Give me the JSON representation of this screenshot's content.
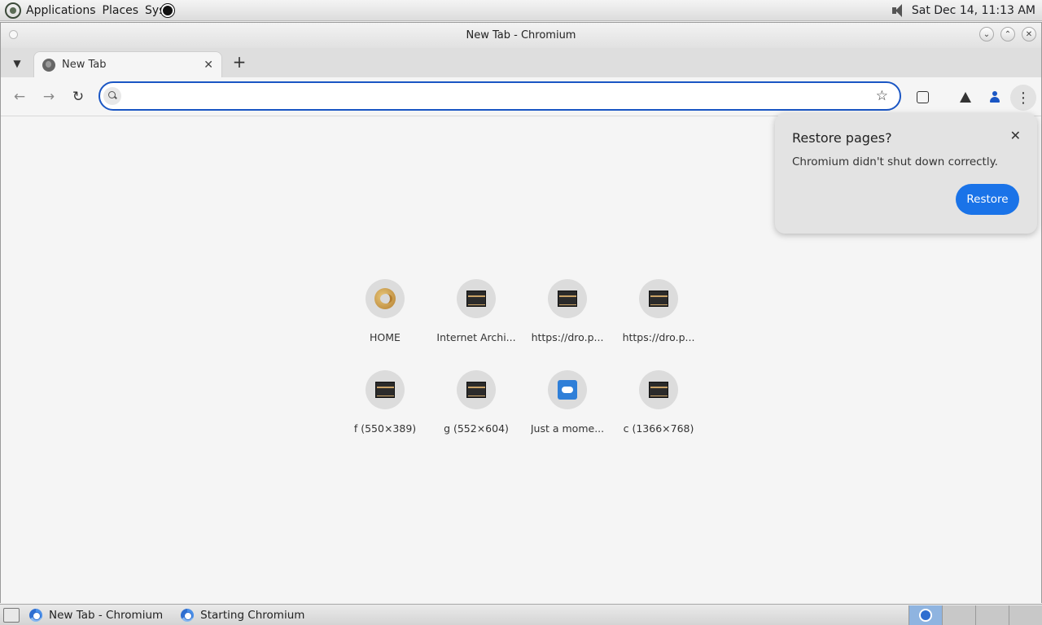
{
  "top_panel": {
    "menus": [
      "Applications",
      "Places",
      "Syst"
    ],
    "datetime": "Sat Dec 14, 11:13 AM"
  },
  "window": {
    "title": "New Tab - Chromium"
  },
  "tabs": [
    {
      "title": "New Tab"
    }
  ],
  "toolbar": {
    "omnibox_value": ""
  },
  "shortcuts": [
    {
      "label": "HOME",
      "icon": "home-icon"
    },
    {
      "label": "Internet Archi...",
      "icon": "thumbnail-icon"
    },
    {
      "label": "https://dro.p...",
      "icon": "thumbnail-icon"
    },
    {
      "label": "https://dro.p...",
      "icon": "thumbnail-icon"
    },
    {
      "label": "f (550×389)",
      "icon": "thumbnail-icon"
    },
    {
      "label": "g (552×604)",
      "icon": "thumbnail-icon"
    },
    {
      "label": "Just a mome...",
      "icon": "cloud-icon"
    },
    {
      "label": "c (1366×768)",
      "icon": "thumbnail-icon"
    }
  ],
  "restore_bubble": {
    "title": "Restore pages?",
    "message": "Chromium didn't shut down correctly.",
    "button": "Restore",
    "accent": "#1a73e8"
  },
  "taskbar": {
    "items": [
      "New Tab - Chromium",
      "Starting Chromium"
    ]
  }
}
